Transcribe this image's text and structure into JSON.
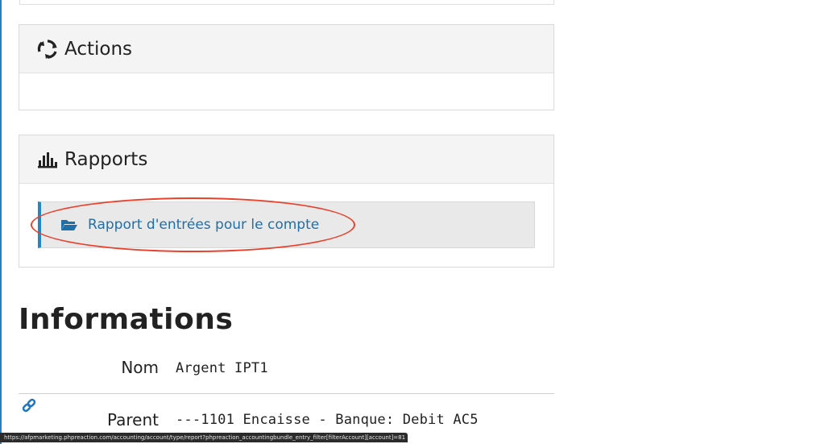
{
  "actions_panel": {
    "title": "Actions",
    "icon": "refresh-icon"
  },
  "reports_panel": {
    "title": "Rapports",
    "icon": "bar-chart-icon",
    "items": [
      {
        "label": "Rapport d'entrées pour le compte",
        "icon": "folder-open-icon"
      }
    ]
  },
  "informations": {
    "title": "Informations",
    "rows": [
      {
        "label": "Nom",
        "value": "Argent IPT1"
      },
      {
        "label": "Parent",
        "value": "---1101 Encaisse - Banque: Debit AC5"
      }
    ]
  },
  "status_bar": {
    "url": "https://afpmarketing.phpreaction.com/accounting/account/type/report?phpreaction_accountingbundle_entry_filter[filterAccount][account]=81"
  },
  "colors": {
    "accent": "#1e88c8",
    "link": "#1f6fa8",
    "highlight": "#e8412c"
  }
}
